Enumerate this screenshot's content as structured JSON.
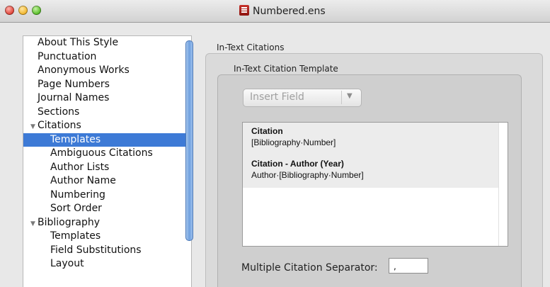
{
  "window": {
    "title": "Numbered.ens"
  },
  "sidebar": {
    "items": [
      {
        "label": "About This Style",
        "level": 0,
        "expandable": false,
        "selected": false
      },
      {
        "label": "Punctuation",
        "level": 0,
        "expandable": false,
        "selected": false
      },
      {
        "label": "Anonymous Works",
        "level": 0,
        "expandable": false,
        "selected": false
      },
      {
        "label": "Page Numbers",
        "level": 0,
        "expandable": false,
        "selected": false
      },
      {
        "label": "Journal Names",
        "level": 0,
        "expandable": false,
        "selected": false
      },
      {
        "label": "Sections",
        "level": 0,
        "expandable": false,
        "selected": false
      },
      {
        "label": "Citations",
        "level": 0,
        "expandable": true,
        "selected": false
      },
      {
        "label": "Templates",
        "level": 1,
        "expandable": false,
        "selected": true
      },
      {
        "label": "Ambiguous Citations",
        "level": 1,
        "expandable": false,
        "selected": false
      },
      {
        "label": "Author Lists",
        "level": 1,
        "expandable": false,
        "selected": false
      },
      {
        "label": "Author Name",
        "level": 1,
        "expandable": false,
        "selected": false
      },
      {
        "label": "Numbering",
        "level": 1,
        "expandable": false,
        "selected": false
      },
      {
        "label": "Sort Order",
        "level": 1,
        "expandable": false,
        "selected": false
      },
      {
        "label": "Bibliography",
        "level": 0,
        "expandable": true,
        "selected": false
      },
      {
        "label": "Templates",
        "level": 1,
        "expandable": false,
        "selected": false
      },
      {
        "label": "Field Substitutions",
        "level": 1,
        "expandable": false,
        "selected": false
      },
      {
        "label": "Layout",
        "level": 1,
        "expandable": false,
        "selected": false
      }
    ],
    "selected_color": "#3d7ad6"
  },
  "panel": {
    "group_label": "In-Text Citations",
    "inner_label": "In-Text Citation Template",
    "insert_field_label": "Insert Field",
    "templates": [
      {
        "name": "Citation",
        "value": "[Bibliography·Number]"
      },
      {
        "name": "Citation - Author (Year)",
        "value": "Author·[Bibliography·Number]"
      }
    ],
    "separator_label": "Multiple Citation Separator:",
    "separator_value": ","
  },
  "icons": {
    "disclosure": "disclosure-triangle-icon",
    "document": "endnote-style-document-icon",
    "dropdown": "chevron-down-icon"
  }
}
